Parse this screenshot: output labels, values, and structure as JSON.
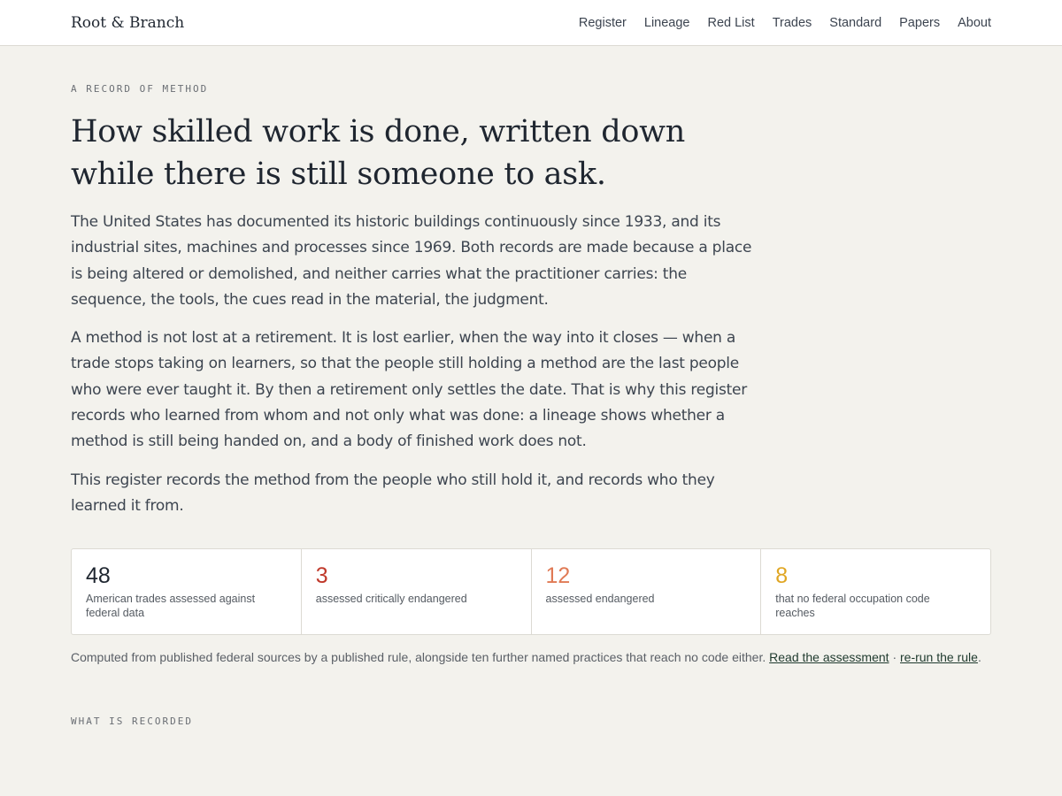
{
  "header": {
    "brand": "Root & Branch",
    "nav": [
      "Register",
      "Lineage",
      "Red List",
      "Trades",
      "Standard",
      "Papers",
      "About"
    ]
  },
  "hero": {
    "eyebrow": "A RECORD OF METHOD",
    "title_line1": "How skilled work is done, written down",
    "title_line2": "while there is still someone to ask.",
    "paragraphs": [
      "The United States has documented its historic buildings continuously since 1933, and its industrial sites, machines and processes since 1969. Both records are made because a place is being altered or demolished, and neither carries what the practitioner carries: the sequence, the tools, the cues read in the material, the judgment.",
      "A method is not lost at a retirement. It is lost earlier, when the way into it closes — when a trade stops taking on learners, so that the people still holding a method are the last people who were ever taught it. By then a retirement only settles the date. That is why this register records who learned from whom and not only what was done: a lineage shows whether a method is still being handed on, and a body of finished work does not.",
      "This register records the method from the people who still hold it, and records who they learned it from."
    ]
  },
  "stats": [
    {
      "value": "48",
      "label": "American trades assessed against federal data",
      "color": "#1f2630"
    },
    {
      "value": "3",
      "label": "assessed critically endangered",
      "color": "#c0392b"
    },
    {
      "value": "12",
      "label": "assessed endangered",
      "color": "#e07a55"
    },
    {
      "value": "8",
      "label": "that no federal occupation code reaches",
      "color": "#e0a623"
    }
  ],
  "footnote": {
    "text": "Computed from published federal sources by a published rule, alongside ten further named practices that reach no code either.",
    "link1": "Read the assessment",
    "sep": "·",
    "link2": "re-run the rule",
    "end": "."
  },
  "section2": {
    "eyebrow": "WHAT IS RECORDED"
  }
}
